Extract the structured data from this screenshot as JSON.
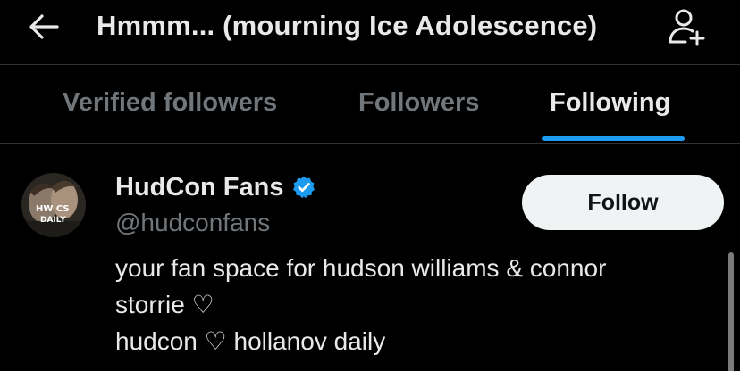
{
  "header": {
    "title": "Hmmm... (mourning Ice Adolescence)"
  },
  "tabs": [
    {
      "label": "Verified followers",
      "active": false
    },
    {
      "label": "Followers",
      "active": false
    },
    {
      "label": "Following",
      "active": true
    }
  ],
  "user": {
    "name": "HudCon Fans",
    "handle": "@hudconfans",
    "verified": true,
    "follow_label": "Follow",
    "bio_lines": [
      "your fan space for hudson williams & connor",
      "storrie ♡",
      "hudcon ♡ hollanov daily"
    ],
    "avatar_text": [
      "HW CS",
      "DAILY"
    ]
  },
  "colors": {
    "background": "#000000",
    "text_primary": "#e7e9ea",
    "text_secondary": "#71767b",
    "accent": "#1d9bf0",
    "button_bg": "#eff3f4"
  }
}
